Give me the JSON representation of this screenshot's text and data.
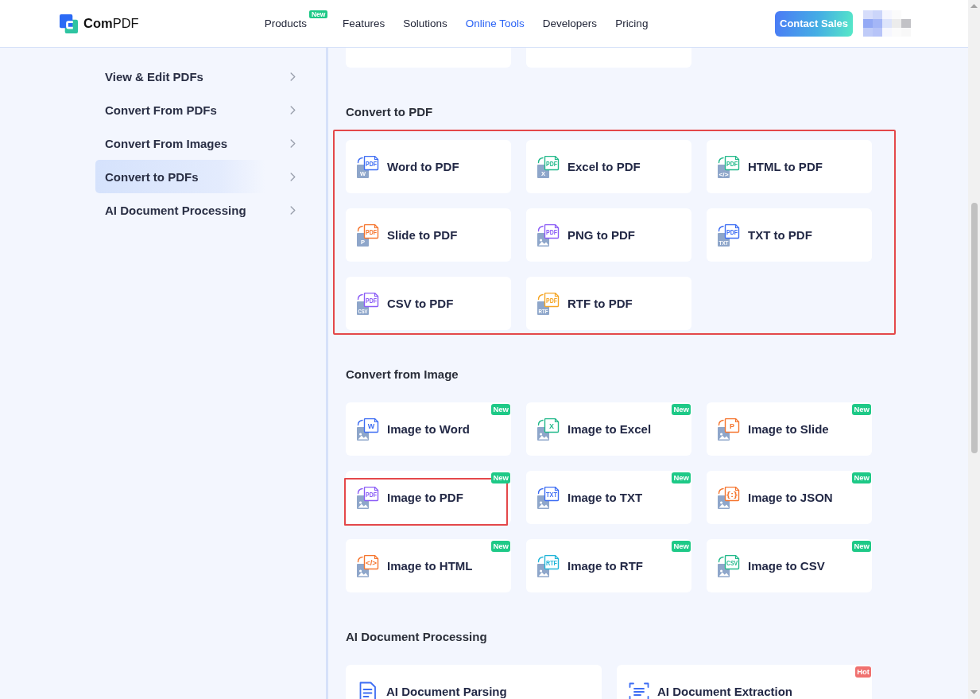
{
  "header": {
    "logo": "**Com**PDF",
    "nav": [
      {
        "label": "Products",
        "selected": false,
        "badge": {
          "text": "New",
          "kind": "new"
        }
      },
      {
        "label": "Features",
        "selected": false
      },
      {
        "label": "Solutions",
        "selected": false
      },
      {
        "label": "Online Tools",
        "selected": true
      },
      {
        "label": "Developers",
        "selected": false
      },
      {
        "label": "Pricing",
        "selected": false
      }
    ],
    "cta": "Contact Sales"
  },
  "sidebar": {
    "items": [
      {
        "label": "View & Edit PDFs",
        "selected": false
      },
      {
        "label": "Convert From PDFs",
        "selected": false
      },
      {
        "label": "Convert From Images",
        "selected": false
      },
      {
        "label": "Convert to PDFs",
        "selected": true
      },
      {
        "label": "AI Document Processing",
        "selected": false
      }
    ]
  },
  "sections": [
    {
      "title": "Convert to PDF",
      "kind": "tools",
      "highlighted": true,
      "cards": [
        {
          "label": "Word to PDF",
          "highlighted": false,
          "icon": {
            "kind": "text-to-doc",
            "source": "W",
            "target": "PDF",
            "color": "#3d6df3"
          }
        },
        {
          "label": "Excel to PDF",
          "highlighted": false,
          "icon": {
            "kind": "text-to-doc",
            "source": "X",
            "target": "PDF",
            "color": "#22b98a"
          }
        },
        {
          "label": "HTML to PDF",
          "highlighted": false,
          "icon": {
            "kind": "text-to-doc",
            "source": "</>",
            "target": "PDF",
            "color": "#22b98a"
          }
        },
        {
          "label": "Slide to PDF",
          "highlighted": false,
          "icon": {
            "kind": "text-to-doc",
            "source": "P",
            "target": "PDF",
            "color": "#f5752e"
          }
        },
        {
          "label": "PNG to PDF",
          "highlighted": false,
          "icon": {
            "kind": "image-to-doc",
            "target": "PDF",
            "color": "#8b5cf6"
          }
        },
        {
          "label": "TXT to PDF",
          "highlighted": false,
          "icon": {
            "kind": "text-to-doc",
            "source": "TXT",
            "target": "PDF",
            "color": "#3d6df3"
          }
        },
        {
          "label": "CSV to PDF",
          "highlighted": false,
          "icon": {
            "kind": "text-to-doc",
            "source": "CSV",
            "target": "PDF",
            "color": "#8b5cf6"
          }
        },
        {
          "label": "RTF to PDF",
          "highlighted": false,
          "icon": {
            "kind": "text-to-doc",
            "source": "RTF",
            "target": "PDF",
            "color": "#f5a524"
          }
        }
      ]
    },
    {
      "title": "Convert from Image",
      "kind": "tools",
      "highlighted": false,
      "cards": [
        {
          "label": "Image to Word",
          "highlighted": false,
          "badge": {
            "text": "New",
            "kind": "new"
          },
          "icon": {
            "kind": "image-to-doc",
            "target": "W",
            "color": "#3d6df3"
          }
        },
        {
          "label": "Image to Excel",
          "highlighted": false,
          "badge": {
            "text": "New",
            "kind": "new"
          },
          "icon": {
            "kind": "image-to-doc",
            "target": "X",
            "color": "#22b98a"
          }
        },
        {
          "label": "Image to Slide",
          "highlighted": false,
          "badge": {
            "text": "New",
            "kind": "new"
          },
          "icon": {
            "kind": "image-to-doc",
            "target": "P",
            "color": "#f5752e"
          }
        },
        {
          "label": "Image to PDF",
          "highlighted": true,
          "badge": {
            "text": "New",
            "kind": "new"
          },
          "icon": {
            "kind": "image-to-doc",
            "target": "PDF",
            "color": "#8b5cf6"
          }
        },
        {
          "label": "Image to TXT",
          "highlighted": false,
          "badge": {
            "text": "New",
            "kind": "new"
          },
          "icon": {
            "kind": "image-to-doc",
            "target": "TXT",
            "color": "#3d6df3"
          }
        },
        {
          "label": "Image to JSON",
          "highlighted": false,
          "badge": {
            "text": "New",
            "kind": "new"
          },
          "icon": {
            "kind": "image-to-doc",
            "target": "{:}",
            "color": "#f5752e"
          }
        },
        {
          "label": "Image to HTML",
          "highlighted": false,
          "badge": {
            "text": "New",
            "kind": "new"
          },
          "icon": {
            "kind": "image-to-doc",
            "target": "</>",
            "color": "#f5752e"
          }
        },
        {
          "label": "Image to RTF",
          "highlighted": false,
          "badge": {
            "text": "New",
            "kind": "new"
          },
          "icon": {
            "kind": "image-to-doc",
            "target": "RTF",
            "color": "#22b5d8"
          }
        },
        {
          "label": "Image to CSV",
          "highlighted": false,
          "badge": {
            "text": "New",
            "kind": "new"
          },
          "icon": {
            "kind": "image-to-doc",
            "target": "CSV",
            "color": "#22b98a"
          }
        }
      ]
    },
    {
      "title": "AI Document Processing",
      "kind": "ai",
      "highlighted": false,
      "cards": [
        {
          "label": "AI Document Parsing",
          "highlighted": false,
          "icon": {
            "kind": "parse"
          }
        },
        {
          "label": "AI Document Extraction",
          "highlighted": false,
          "badge": {
            "text": "Hot",
            "kind": "hot"
          },
          "icon": {
            "kind": "extract"
          }
        }
      ]
    }
  ]
}
